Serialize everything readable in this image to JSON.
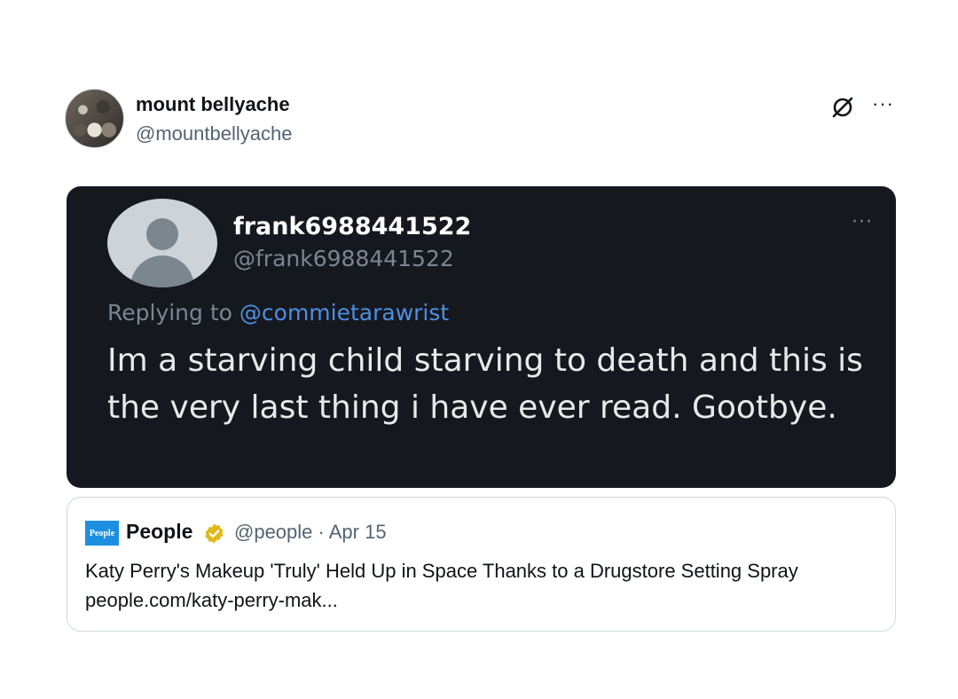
{
  "post": {
    "author": {
      "display_name": "mount bellyache",
      "handle": "@mountbellyache"
    },
    "icons": {
      "grok": "grok-icon",
      "more": "more-icon"
    },
    "more_label": "···"
  },
  "embedded_screenshot": {
    "author": {
      "name": "frank6988441522",
      "handle": "@frank6988441522"
    },
    "more_label": "···",
    "replying_prefix": "Replying to",
    "replying_to": "@commietarawrist",
    "text": "Im a starving child starving to death and this is the very last thing i have ever read. Gootbye."
  },
  "quote": {
    "logo_text": "People",
    "name": "People",
    "handle_date": "@people · Apr 15",
    "text": "Katy Perry's Makeup 'Truly' Held Up in Space Thanks to a Drugstore Setting Spray people.com/katy-perry-mak..."
  },
  "colors": {
    "accent_mention": "#4d8fe0",
    "embed_background": "#16181f",
    "verified_gold": "#e2b719",
    "people_blue": "#1d8fe0"
  }
}
